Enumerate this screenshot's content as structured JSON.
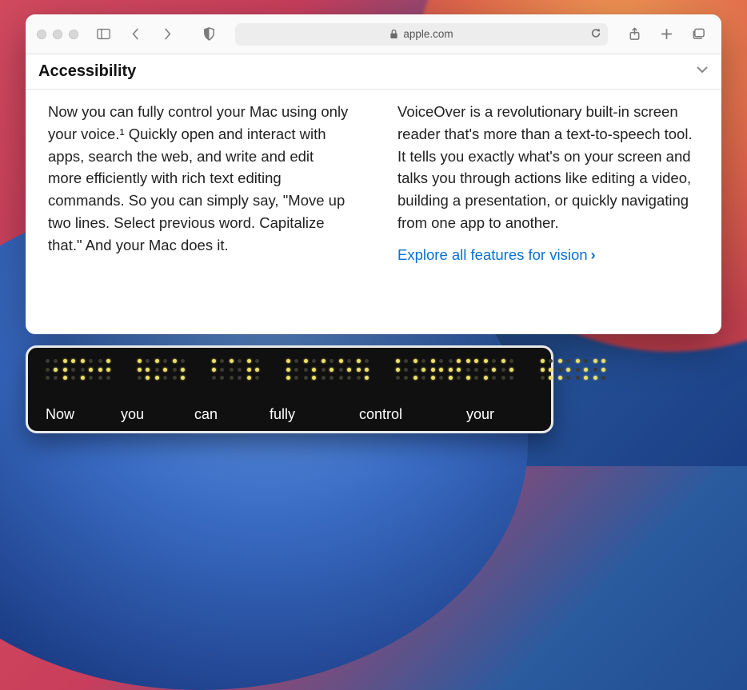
{
  "window": {
    "address": "apple.com",
    "page_title": "Accessibility"
  },
  "content": {
    "left": "Now you can fully control your Mac using only your voice.¹ Quickly open and interact with apps, search the web, and write and edit more efficiently with rich text editing commands. So you can simply say, \"Move up two lines. Select previous word. Capitalize that.\" And your Mac does it.",
    "right": "VoiceOver is a revolutionary built-in screen reader that's more than a text-to-speech tool. It tells you exactly what's on your screen and talks you through actions like editing a video, building a presentation, or quickly navigating from one app to another.",
    "link": "Explore all features for vision"
  },
  "braille": {
    "words": [
      "Now",
      "you",
      "can",
      "fully",
      "control",
      "your"
    ],
    "cells": [
      [
        [
          0,
          0,
          0,
          0,
          1,
          0
        ],
        [
          1,
          1,
          1,
          1,
          0,
          0
        ],
        [
          1,
          0,
          1,
          0,
          1,
          0
        ],
        [
          0,
          1,
          0,
          1,
          1,
          0
        ]
      ],
      [
        [
          1,
          1,
          0,
          0,
          1,
          1
        ],
        [
          1,
          0,
          1,
          0,
          1,
          0
        ],
        [
          1,
          0,
          0,
          0,
          1,
          1
        ]
      ],
      [
        [
          1,
          1,
          0,
          0,
          0,
          0
        ],
        [
          1,
          0,
          0,
          0,
          0,
          0
        ],
        [
          1,
          1,
          1,
          0,
          1,
          0
        ]
      ],
      [
        [
          1,
          1,
          1,
          0,
          0,
          0
        ],
        [
          1,
          0,
          0,
          0,
          1,
          1
        ],
        [
          1,
          0,
          0,
          0,
          1,
          0
        ],
        [
          1,
          0,
          0,
          0,
          1,
          0
        ],
        [
          1,
          1,
          0,
          0,
          1,
          1
        ]
      ],
      [
        [
          1,
          1,
          0,
          0,
          0,
          0
        ],
        [
          1,
          0,
          1,
          0,
          1,
          0
        ],
        [
          1,
          1,
          1,
          0,
          1,
          0
        ],
        [
          0,
          1,
          1,
          1,
          1,
          0
        ],
        [
          1,
          0,
          1,
          1,
          0,
          0
        ],
        [
          1,
          0,
          1,
          0,
          1,
          0
        ],
        [
          1,
          0,
          0,
          0,
          1,
          0
        ]
      ],
      [
        [
          1,
          1,
          0,
          0,
          1,
          1
        ],
        [
          1,
          0,
          1,
          0,
          1,
          0
        ],
        [
          1,
          0,
          0,
          0,
          1,
          1
        ],
        [
          1,
          0,
          1,
          1,
          1,
          0
        ]
      ]
    ]
  }
}
